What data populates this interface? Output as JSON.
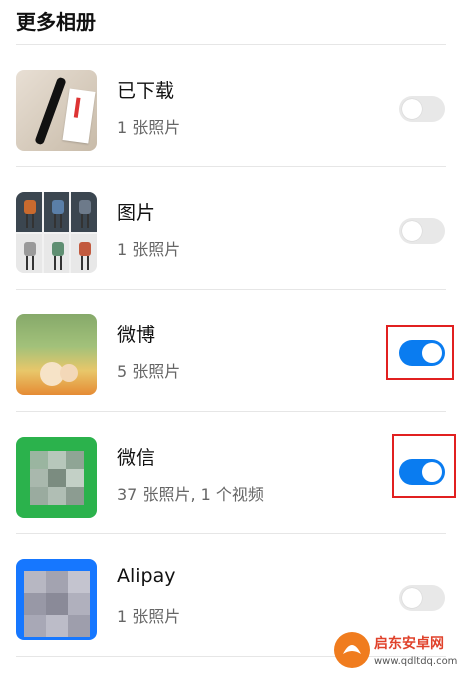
{
  "header": {
    "title": "更多相册"
  },
  "albums": [
    {
      "title": "已下载",
      "subtitle": "1 张照片",
      "toggle": "off"
    },
    {
      "title": "图片",
      "subtitle": "1 张照片",
      "toggle": "off"
    },
    {
      "title": "微博",
      "subtitle": "5 张照片",
      "toggle": "on"
    },
    {
      "title": "微信",
      "subtitle": "37 张照片, 1 个视频",
      "toggle": "on"
    },
    {
      "title": "Alipay",
      "subtitle": "1 张照片",
      "toggle": "off"
    }
  ],
  "colors": {
    "toggle_on": "#0a7cf0",
    "toggle_off": "#e8e8e8",
    "highlight": "#e12020"
  },
  "watermark": {
    "brand": "启东安卓网",
    "url": "www.qdltdq.com"
  }
}
